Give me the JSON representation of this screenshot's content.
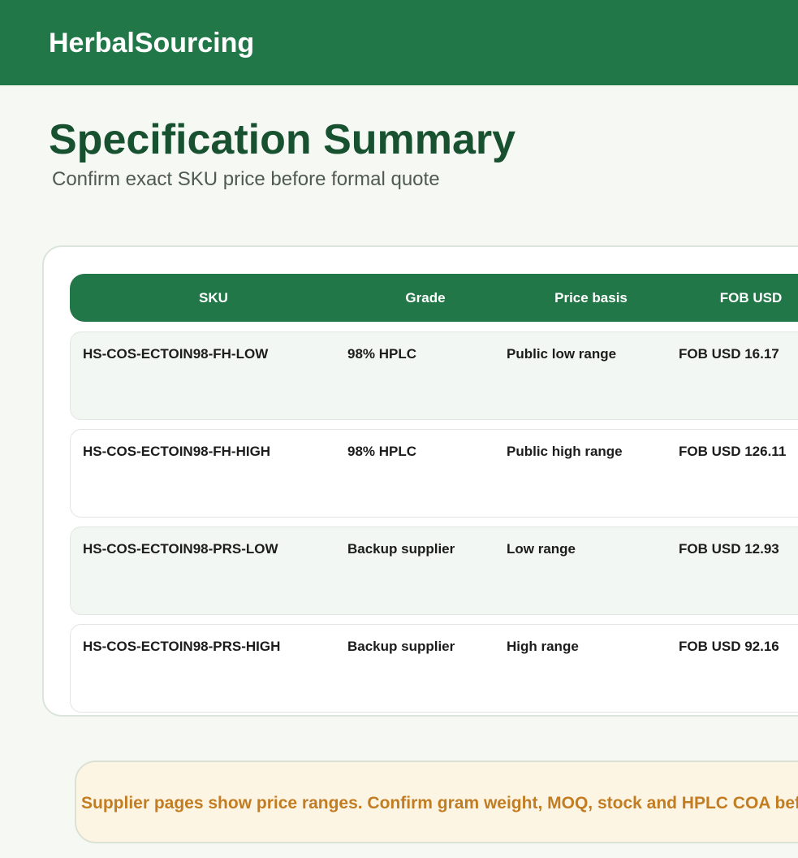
{
  "header": {
    "brand": "HerbalSourcing"
  },
  "page": {
    "title": "Specification Summary",
    "subtitle": "Confirm exact SKU price before formal quote"
  },
  "table": {
    "columns": [
      "SKU",
      "Grade",
      "Price basis",
      "FOB USD"
    ],
    "rows": [
      {
        "sku": "HS-COS-ECTOIN98-FH-LOW",
        "grade": "98% HPLC",
        "basis": "Public low range",
        "fob": "FOB USD 16.17"
      },
      {
        "sku": "HS-COS-ECTOIN98-FH-HIGH",
        "grade": "98% HPLC",
        "basis": "Public high range",
        "fob": "FOB USD 126.11"
      },
      {
        "sku": "HS-COS-ECTOIN98-PRS-LOW",
        "grade": "Backup supplier",
        "basis": "Low range",
        "fob": "FOB USD 12.93"
      },
      {
        "sku": "HS-COS-ECTOIN98-PRS-HIGH",
        "grade": "Backup supplier",
        "basis": "High range",
        "fob": "FOB USD 92.16"
      }
    ]
  },
  "notice": {
    "text": "Supplier pages show price ranges. Confirm gram weight, MOQ, stock and HPLC COA before formal quote."
  },
  "colors": {
    "header_bg": "#217747",
    "title": "#175130",
    "notice_text": "#c27c22",
    "notice_bg": "#fdf5e4"
  }
}
